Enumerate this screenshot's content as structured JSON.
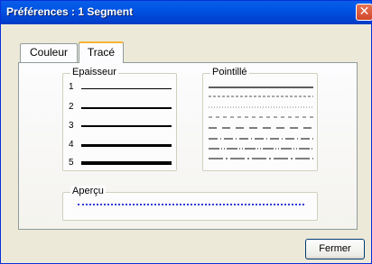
{
  "window": {
    "title": "Préférences : 1 Segment",
    "close_glyph": "✕"
  },
  "tabs": [
    {
      "label": "Couleur"
    },
    {
      "label": "Tracé"
    }
  ],
  "epaisseur": {
    "label": "Epaisseur",
    "items": [
      {
        "label": "1"
      },
      {
        "label": "2"
      },
      {
        "label": "3"
      },
      {
        "label": "4"
      },
      {
        "label": "5"
      }
    ]
  },
  "pointille": {
    "label": "Pointillé"
  },
  "apercu": {
    "label": "Aperçu",
    "line_color": "#2f3bd8"
  },
  "buttons": {
    "close_label": "Fermer"
  }
}
